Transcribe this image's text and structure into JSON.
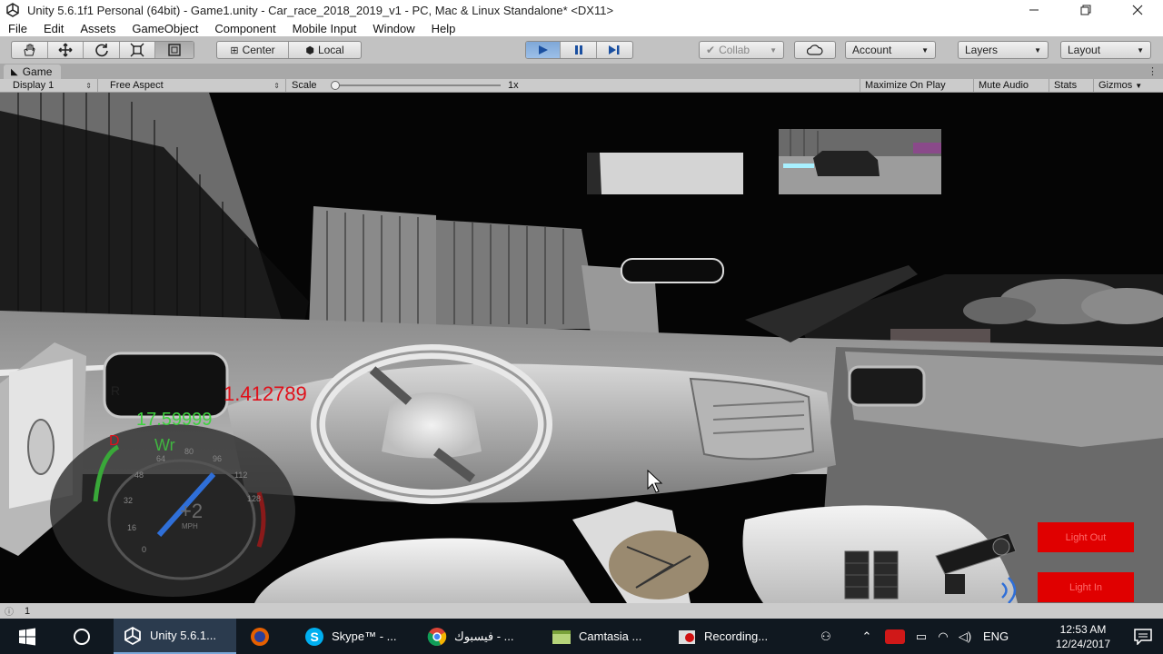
{
  "window": {
    "title": "Unity 5.6.1f1 Personal (64bit) - Game1.unity - Car_race_2018_2019_v1 - PC, Mac & Linux Standalone* <DX11>"
  },
  "menu": [
    "File",
    "Edit",
    "Assets",
    "GameObject",
    "Component",
    "Mobile Input",
    "Window",
    "Help"
  ],
  "toolbar": {
    "pivot": "Center",
    "space": "Local",
    "collab": "Collab",
    "account": "Account",
    "layers": "Layers",
    "layout": "Layout"
  },
  "game_tab": {
    "label": "Game"
  },
  "game_controls": {
    "display": "Display 1",
    "aspect": "Free Aspect",
    "scale_label": "Scale",
    "scale_value": "1x",
    "maximize": "Maximize On Play",
    "mute": "Mute Audio",
    "stats": "Stats",
    "gizmos": "Gizmos"
  },
  "hud": {
    "value_red": "1.412789",
    "value_green": "17.59999",
    "gear_r": "R",
    "gear_d": "D",
    "speed_label": "Wr",
    "speed_readout": "+2",
    "speed_unit": "MPH",
    "dial_ticks": [
      "0",
      "16",
      "32",
      "48",
      "64",
      "80",
      "96",
      "112",
      "128"
    ],
    "light_out": "Light Out",
    "light_in": "Light In"
  },
  "status": {
    "text": "1"
  },
  "taskbar": {
    "items": [
      {
        "label": "Unity 5.6.1..."
      },
      {
        "label": ""
      },
      {
        "label": "Skype™ - ..."
      },
      {
        "label": "فيسبوك - ..."
      },
      {
        "label": "Camtasia ..."
      },
      {
        "label": "Recording..."
      }
    ],
    "language": "ENG",
    "time": "12:53 AM",
    "date": "12/24/2017"
  },
  "colors": {
    "accent": "#3a7bd5",
    "hud_red": "#e0101a",
    "hud_green": "#3fd13f",
    "button_red": "#e00000"
  }
}
